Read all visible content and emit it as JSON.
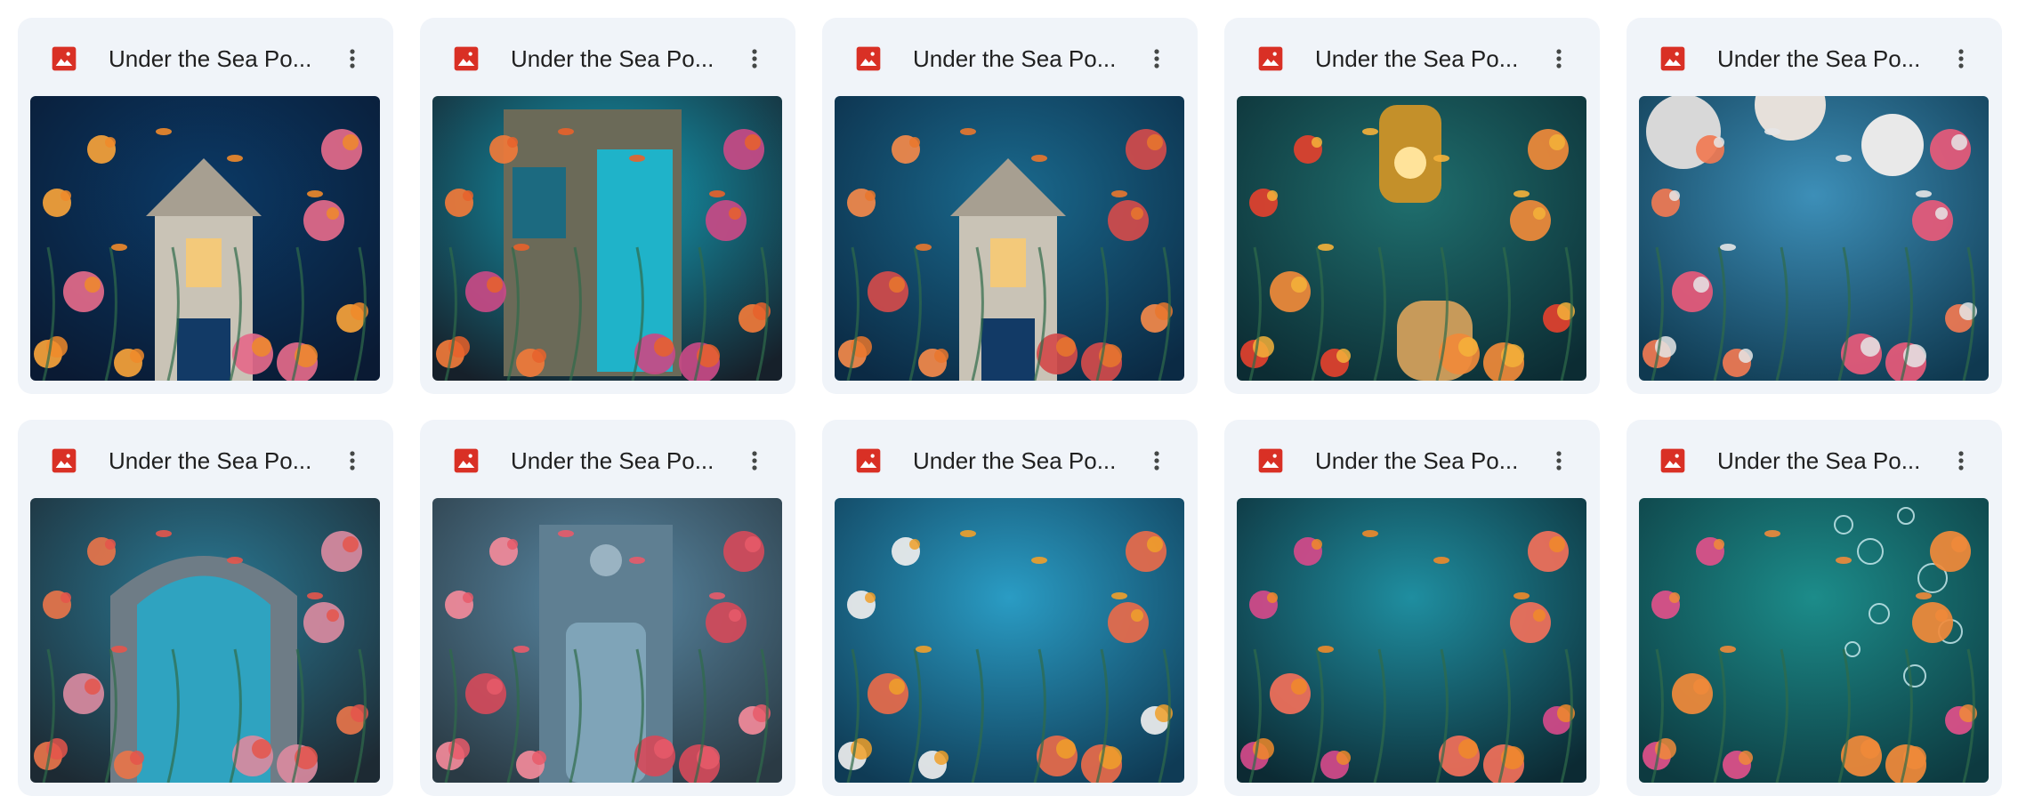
{
  "files": [
    {
      "title": "Under the Sea Po...",
      "thumbnail": "sea-house-flowers",
      "scene": {
        "bg1": "#0b3a66",
        "bg2": "#0a1a33",
        "accent": "#f08a2a",
        "flower1": "#f6a23a",
        "flower2": "#e46a8a",
        "feature": "house"
      }
    },
    {
      "title": "Under the Sea Po...",
      "thumbnail": "sea-window-door",
      "scene": {
        "bg1": "#14a0b8",
        "bg2": "#16202a",
        "accent": "#e8622b",
        "flower1": "#f07a3a",
        "flower2": "#c84a86",
        "feature": "window"
      }
    },
    {
      "title": "Under the Sea Po...",
      "thumbnail": "sea-gothic-house-fish",
      "scene": {
        "bg1": "#1a6a8e",
        "bg2": "#0b2a44",
        "accent": "#e9772d",
        "flower1": "#f3894a",
        "flower2": "#d24b4b",
        "feature": "house"
      }
    },
    {
      "title": "Under the Sea Po...",
      "thumbnail": "sea-lantern-chair",
      "scene": {
        "bg1": "#1f6f6e",
        "bg2": "#0c2c33",
        "accent": "#f5b13a",
        "flower1": "#e2412e",
        "flower2": "#f08a3a",
        "feature": "lantern"
      }
    },
    {
      "title": "Under the Sea Po...",
      "thumbnail": "sea-balloons-coral",
      "scene": {
        "bg1": "#3d8fb8",
        "bg2": "#0f3950",
        "accent": "#e6e6e6",
        "flower1": "#f17a52",
        "flower2": "#e85a7a",
        "feature": "balloons"
      }
    },
    {
      "title": "Under the Sea Po...",
      "thumbnail": "sea-arched-window",
      "scene": {
        "bg1": "#2a7a95",
        "bg2": "#1d2a33",
        "accent": "#e5554b",
        "flower1": "#e7744a",
        "flower2": "#d98aa0",
        "feature": "arch"
      }
    },
    {
      "title": "Under the Sea Po...",
      "thumbnail": "sea-blue-door-roses",
      "scene": {
        "bg1": "#5a8aa6",
        "bg2": "#2a3a44",
        "accent": "#e85b6a",
        "flower1": "#f28a9a",
        "flower2": "#d44a5a",
        "feature": "door"
      }
    },
    {
      "title": "Under the Sea Po...",
      "thumbnail": "sea-open-water",
      "scene": {
        "bg1": "#2a9cc4",
        "bg2": "#0f3b55",
        "accent": "#f0a02a",
        "flower1": "#eeeeee",
        "flower2": "#e86a4a",
        "feature": "open"
      }
    },
    {
      "title": "Under the Sea Po...",
      "thumbnail": "sea-reef-fish",
      "scene": {
        "bg1": "#1f8ea0",
        "bg2": "#0c2a33",
        "accent": "#f08a2a",
        "flower1": "#d44a8a",
        "flower2": "#f2705a",
        "feature": "open"
      }
    },
    {
      "title": "Under the Sea Po...",
      "thumbnail": "sea-bubbles-coral",
      "scene": {
        "bg1": "#1c8c8a",
        "bg2": "#0d3a40",
        "accent": "#f08a3a",
        "flower1": "#e0508a",
        "flower2": "#f28a3a",
        "feature": "bubbles"
      }
    }
  ],
  "menu_icon": "more-vert-icon",
  "file_icon": "image-file-icon",
  "colors": {
    "card_bg": "#f0f4f9",
    "icon_red": "#d93025",
    "title": "#1f1f1f"
  }
}
